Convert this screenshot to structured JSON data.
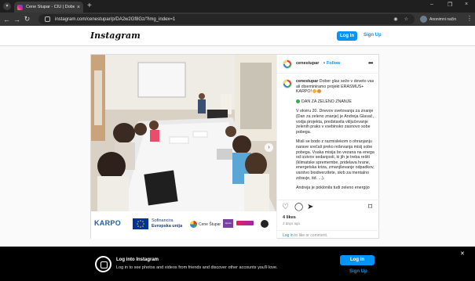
{
  "browser": {
    "tab_title": "Cene Štupar - CIU | Dober glas...",
    "url": "instagram.com/cenestupar/p/DA2w2Gf8Gz/?img_index=1",
    "profile_label": "Anonimni način",
    "tab_close": "×",
    "new_tab": "+",
    "win_controls": [
      "–",
      "❐",
      "×"
    ]
  },
  "header": {
    "logo": "Instagram",
    "login_label": "Log In",
    "signup_label": "Sign Up"
  },
  "post": {
    "username": "cenestupar",
    "dot": "•",
    "follow_label": "Follow",
    "caption": {
      "intro": "Dober glas seže v deveto vas ali diseminiramo projekt ERASMUS+ KARPO!",
      "heading": "DAN ZA ZELENO ZNANJE",
      "para1": "V okviru 20. Dnevov svetovanja za znanje (Dan za zeleno znanje) je Andreja Glavač, vodja projekta, predstavila vključevanje zelenih praks v vsebinsko zasnovo sobe pobega.",
      "para2": "Misli se bodo z razmislekom o ohranjanju narave srečali preko reševanja misij sobe pobega. Vsaka misija bo vezana na enega od izzivov sedanjosti, ki jih je treba rešiti (klimatske spremembe, pridelava hrane, energetska kriza, zmanjševanje odpadkov, varstvo biodiverzitete, skrb za mentalno zdravje, itd. ...).",
      "para3": "Andreja je poklonila tudi zeleno energijo"
    },
    "logos": {
      "karpo": "KARPO",
      "eu_line1": "Sofinancira",
      "eu_line2": "Evropska unija",
      "cene": "Cene Štupar",
      "purple": "zipnet"
    },
    "likes": "4 likes",
    "time": "2 days ago",
    "login_link": "Log in",
    "login_rest": " to like or comment."
  },
  "banner": {
    "title": "Log into Instagram",
    "subtitle": "Log in to see photos and videos from friends and discover other accounts you'll love.",
    "login_label": "Log in",
    "signup_label": "Sign Up"
  },
  "icons": {
    "heart": "heart-icon",
    "comment": "comment-icon",
    "share": "share-icon",
    "save": "bookmark-icon"
  },
  "colors": {
    "accent": "#0095f6",
    "chrome_dark": "#1f1f1f"
  }
}
